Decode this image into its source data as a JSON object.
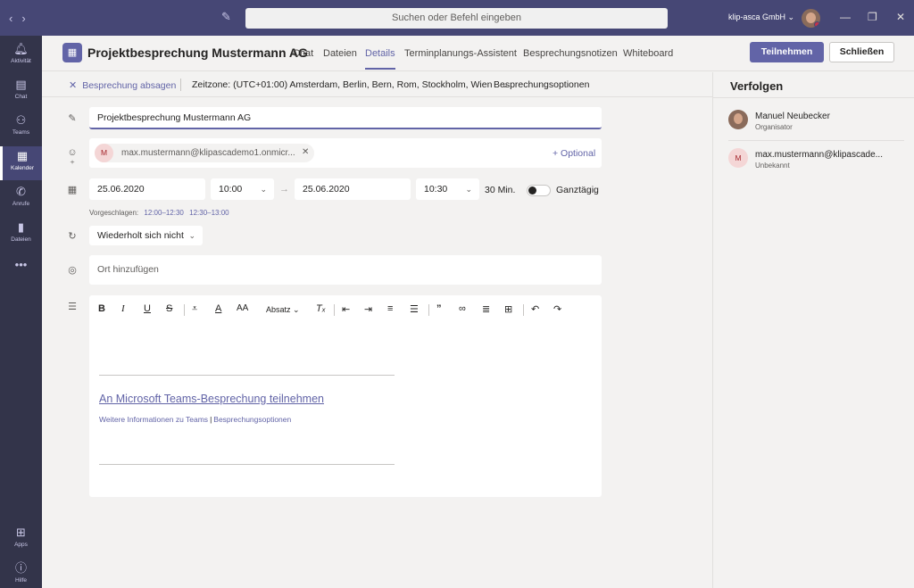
{
  "titlebar": {
    "search_placeholder": "Suchen oder Befehl eingeben",
    "org_name": "klip-asca GmbH ⌄"
  },
  "rail": {
    "items": [
      {
        "label": "Aktivität",
        "icon": "bell-icon"
      },
      {
        "label": "Chat",
        "icon": "chat-icon"
      },
      {
        "label": "Teams",
        "icon": "teams-icon"
      },
      {
        "label": "Kalender",
        "icon": "calendar-icon"
      },
      {
        "label": "Anrufe",
        "icon": "phone-icon"
      },
      {
        "label": "Dateien",
        "icon": "file-icon"
      },
      {
        "label": "Apps",
        "icon": "apps-icon"
      },
      {
        "label": "Hilfe",
        "icon": "help-icon"
      }
    ]
  },
  "header": {
    "title": "Projektbesprechung Mustermann AG",
    "tabs": [
      "Chat",
      "Dateien",
      "Details",
      "Terminplanungs-Assistent",
      "Besprechungsnotizen",
      "Whiteboard"
    ],
    "active_tab": "Details",
    "join_label": "Teilnehmen",
    "close_label": "Schließen"
  },
  "subbar": {
    "cancel_label": "Besprechung absagen",
    "timezone": "Zeitzone: (UTC+01:00) Amsterdam, Berlin, Bern, Rom, Stockholm, Wien",
    "meeting_options": "Besprechungsoptionen"
  },
  "form": {
    "title_value": "Projektbesprechung Mustermann AG",
    "attendee_initial": "M",
    "attendee_email": "max.mustermann@klipascademo1.onmicr...",
    "optional_label": "+ Optional",
    "start_date": "25.06.2020",
    "start_time": "10:00",
    "end_date": "25.06.2020",
    "end_time": "10:30",
    "duration": "30 Min.",
    "all_day_label": "Ganztägig",
    "suggest_label": "Vorgeschlagen:",
    "suggestions": [
      "12:00–12:30",
      "12:30–13:00"
    ],
    "repeat_value": "Wiederholt sich nicht",
    "location_placeholder": "Ort hinzufügen"
  },
  "editor": {
    "paragraph_style": "Absatz",
    "join_link": "An Microsoft Teams-Besprechung teilnehmen",
    "more_info": "Weitere Informationen zu Teams",
    "meeting_options_link": "Besprechungsoptionen"
  },
  "tracking": {
    "title": "Verfolgen",
    "people": [
      {
        "name": "Manuel Neubecker",
        "role": "Organisator"
      },
      {
        "initial": "M",
        "name": "max.mustermann@klipascade...",
        "role": "Unbekannt"
      }
    ]
  },
  "colors": {
    "accent": "#6264a7",
    "titlebar": "#464775",
    "rail": "#33344a"
  }
}
